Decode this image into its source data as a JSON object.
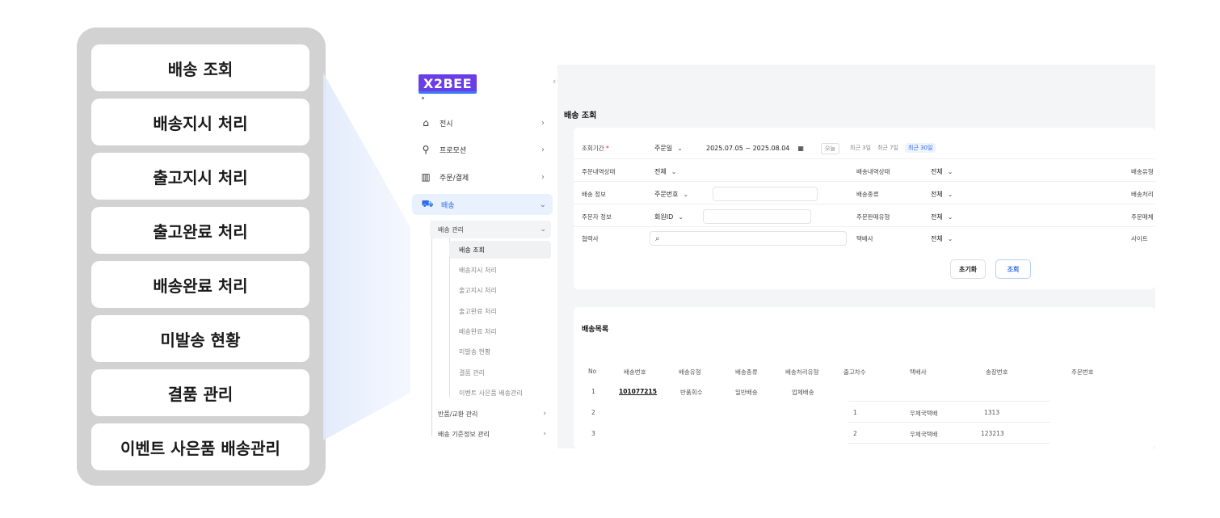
{
  "callout_items": [
    "배송 조회",
    "배송지시 처리",
    "출고지시 처리",
    "출고완료 처리",
    "배송완료 처리",
    "미발송 현황",
    "결품 관리",
    "이벤트 사은품 배송관리"
  ],
  "app": {
    "logo": "X2BEE",
    "collapse_glyph": "‹",
    "sidebar": {
      "menus": [
        {
          "label": "전시",
          "icon": "bag-icon",
          "glyph": "⌂"
        },
        {
          "label": "프로모션",
          "icon": "badge-icon",
          "glyph": "⚲"
        },
        {
          "label": "주문/결제",
          "icon": "barcode-icon",
          "glyph": "▥"
        },
        {
          "label": "배송",
          "icon": "truck-icon",
          "glyph": "⛟"
        }
      ],
      "submenu_open": "배송 관리",
      "leaves": [
        "배송 조회",
        "배송지시 처리",
        "출고지시 처리",
        "출고완료 처리",
        "배송완료 처리",
        "미발송 현황",
        "결품 관리",
        "이벤트 사은품 배송관리"
      ],
      "more_submenus": [
        "반품/교환 관리",
        "배송 기준정보 관리"
      ]
    },
    "page_title": "배송 조회",
    "filters": {
      "period_label": "조회기간",
      "period_required": "*",
      "period_type": "주문일",
      "date_range": "2025.07.05 ~ 2025.08.04",
      "quick": [
        "오늘",
        "최근 3일",
        "최근 7일",
        "최근 30일"
      ],
      "order_status_label": "주문내역상태",
      "order_status_value": "전체",
      "ship_status_label": "배송내역상태",
      "ship_status_value": "전체",
      "ship_type_label_partial": "배송유형",
      "ship_info_label": "배송 정보",
      "ship_info_type": "주문번호",
      "ship_kind_label": "배송종류",
      "ship_kind_value": "전체",
      "ship_proc_label_partial": "배송처리",
      "orderer_label": "주문자 정보",
      "orderer_type": "회원ID",
      "sale_type_label": "주문판매유형",
      "sale_type_value": "전체",
      "order_media_label_partial": "주문매체",
      "partner_label": "협력사",
      "courier_label": "택배사",
      "courier_value": "전체",
      "site_label": "사이트",
      "reset_button": "초기화",
      "search_button": "조회"
    },
    "list": {
      "title": "배송목록",
      "columns": [
        "No",
        "배송번호",
        "배송유형",
        "배송종류",
        "배송처리유형",
        "출고차수",
        "택배사",
        "송장번호",
        "주문번호"
      ],
      "rows": [
        {
          "no": "1",
          "ship_no": "101077215",
          "ship_type": "반품회수",
          "ship_kind": "일반배송",
          "proc_type": "업체배송",
          "out_seq": "",
          "courier": "",
          "invoice": ""
        },
        {
          "no": "2",
          "ship_no": "",
          "ship_type": "",
          "ship_kind": "",
          "proc_type": "",
          "out_seq": "1",
          "courier": "우체국택배",
          "invoice": "1313"
        },
        {
          "no": "3",
          "ship_no": "",
          "ship_type": "",
          "ship_kind": "",
          "proc_type": "",
          "out_seq": "2",
          "courier": "우체국택배",
          "invoice": "123213"
        }
      ]
    }
  },
  "colors": {
    "accent": "#2c6bed",
    "panel": "#d2d2d2",
    "logo": "#6a3ee6"
  }
}
